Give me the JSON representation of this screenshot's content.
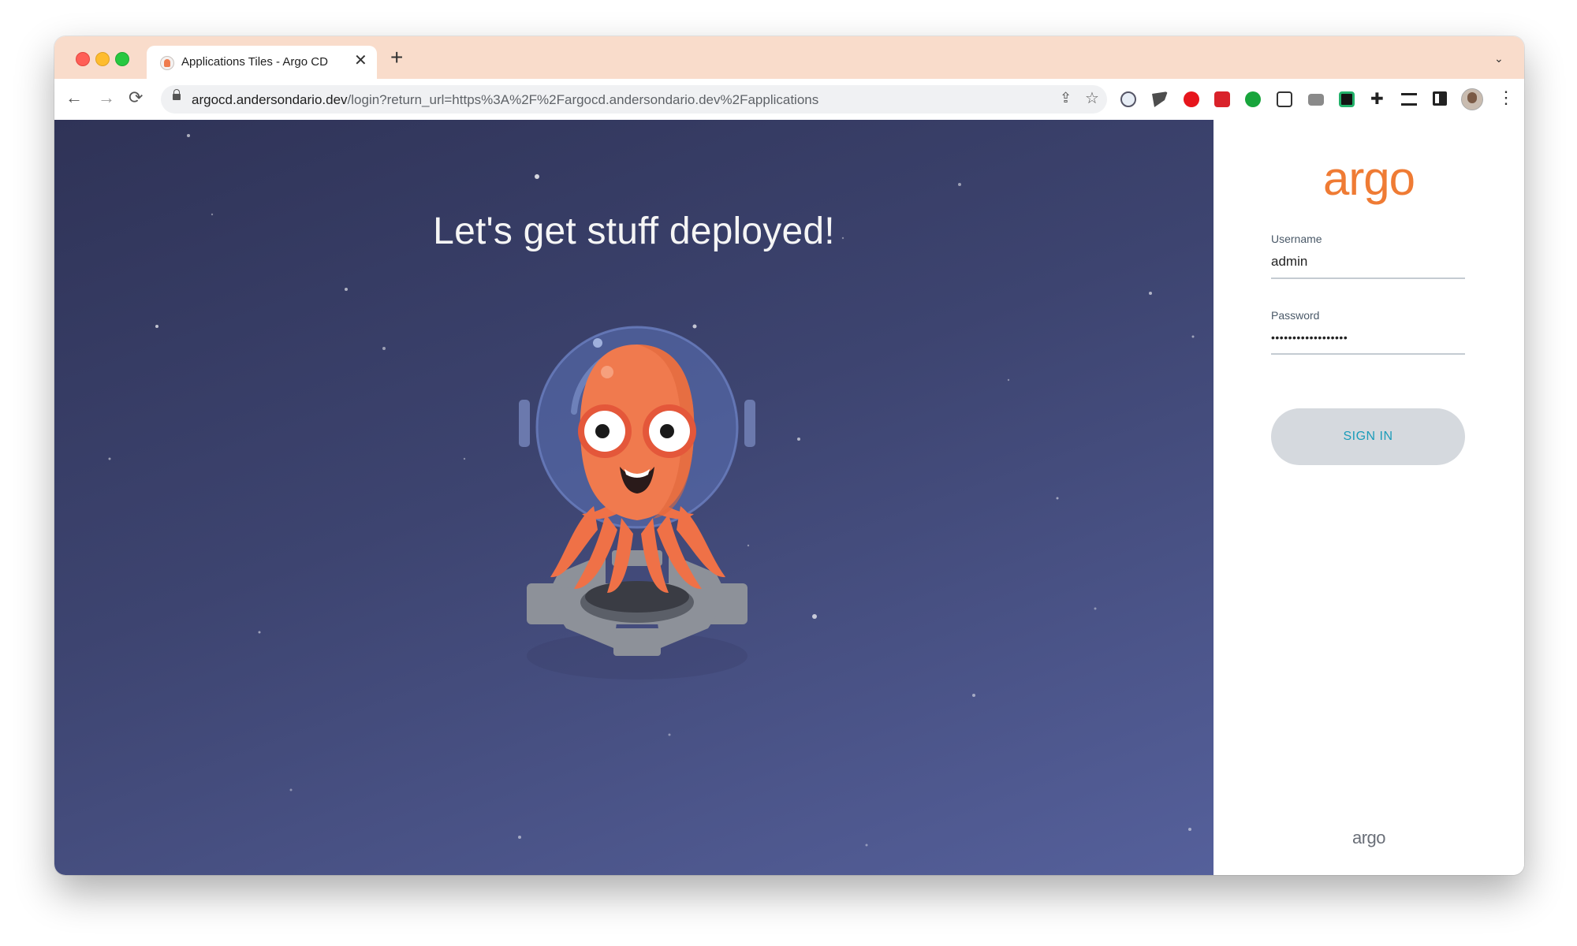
{
  "browser": {
    "tab_title": "Applications Tiles - Argo CD",
    "tab_close": "✕",
    "new_tab": "+",
    "tab_menu": "⌄",
    "url_host": "argocd.andersondario.dev",
    "url_path": "/login?return_url=https%3A%2F%2Fargocd.andersondario.dev%2Fapplications",
    "nav": {
      "back": "←",
      "forward": "→",
      "reload": "⟳"
    },
    "menu_icon": "⋮",
    "extensions": [
      "password-manager-icon",
      "flag-icon",
      "shield-icon",
      "puzzle-red-icon",
      "check-icon",
      "send-icon",
      "camera-icon",
      "dollar-icon",
      "extensions-icon",
      "reading-list-icon",
      "side-panel-icon"
    ]
  },
  "hero": {
    "title": "Let's get stuff deployed!"
  },
  "login": {
    "logo": "argo",
    "username_label": "Username",
    "username_value": "admin",
    "password_label": "Password",
    "password_value": "••••••••••••••••••",
    "signin_label": "SIGN IN",
    "footer_logo": "argo"
  },
  "colors": {
    "accent": "#ef7b34",
    "button_text": "#1b9cb9",
    "titlebar": "#f9dccb",
    "hero_bg": "#3d4470"
  }
}
